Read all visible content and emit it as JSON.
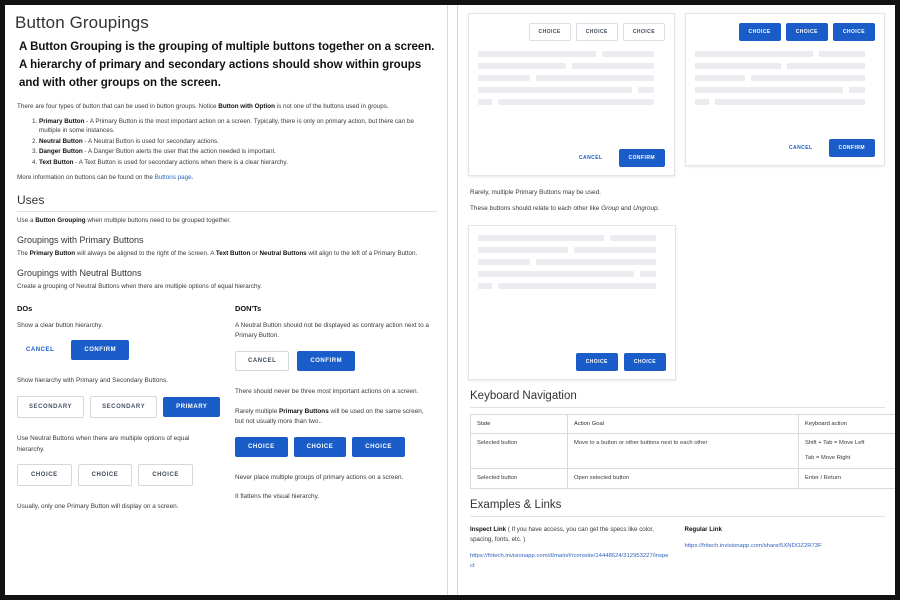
{
  "left": {
    "page_title": "Button Groupings",
    "lede": "A Button Grouping is the grouping of multiple buttons together on a screen. A hierarchy of primary and secondary actions should show within groups and with other groups on the screen.",
    "intro_before": "There are four types of button that can be used in button groups. Notice ",
    "intro_bold": "Button with Option",
    "intro_after": " is not one of the buttons used in groups.",
    "types": [
      {
        "term": "Primary Button",
        "desc": " - A Primary Button is the most important action on a screen. Typically, there is only on primary action, but there can be multiple in some instances."
      },
      {
        "term": "Neutral Button",
        "desc": " - A Neutral Button is used for secondary actions."
      },
      {
        "term": "Danger Button",
        "desc": " - A Danger Button alerts the user that the action needed is important."
      },
      {
        "term": "Text Button",
        "desc": " - A Text Button is used for secondary actions when there is a clear hierarchy."
      }
    ],
    "more_info_before": "More information on buttons can be found on the ",
    "more_info_link": "Buttons page",
    "more_info_after": ".",
    "uses_heading": "Uses",
    "uses_before": "Use a ",
    "uses_bold": "Button Grouping",
    "uses_after": " when multiple buttons need to be grouped together.",
    "primary_heading": "Groupings with Primary Buttons",
    "primary_p1": "The ",
    "primary_b1": "Primary Button",
    "primary_p2": " will always be aligned to the right of the screen. A ",
    "primary_b2": "Text Button",
    "primary_p3": " or ",
    "primary_b3": "Neutral Buttons",
    "primary_p4": " will align to the left of a Primary Button.",
    "neutral_heading": "Groupings with Neutral Buttons",
    "neutral_text": "Create a grouping of Neutral Buttons when there are multiple options of equal hierarchy.",
    "dos": {
      "heading": "DOs",
      "p1": "Show a clear button hierarchy.",
      "btn_cancel": "CANCEL",
      "btn_confirm": "CONFIRM",
      "p2": "Show hierarchy with Primary and Secondary Buttons.",
      "btn_secondary_1": "SECONDARY",
      "btn_secondary_2": "SECONDARY",
      "btn_primary": "PRIMARY",
      "p3": "Use Neutral Buttons when there are multiple options of equal hierarchy.",
      "choice_1": "CHOICE",
      "choice_2": "CHOICE",
      "choice_3": "CHOICE",
      "p4": "Usually, only one Primary Button will display on a screen."
    },
    "donts": {
      "heading": "DON'Ts",
      "p1": "A Neutral Button should not be displayed as contrary action next to a Primary Button.",
      "btn_cancel": "CANCEL",
      "btn_confirm": "CONFIRM",
      "p2": "There should never be three most important actions on a screen.",
      "p3_a": "Rarely multiple ",
      "p3_b": "Primary Buttons",
      "p3_c": " will be used on the same screen, but not usually more than two..",
      "choice_1": "CHOICE",
      "choice_2": "CHOICE",
      "choice_3": "CHOICE",
      "p4": "Never place multiple groups of primary actions on a screen.",
      "p5": "It flattens the visual hierarchy."
    }
  },
  "right": {
    "mock_a": {
      "choice_1": "CHOICE",
      "choice_2": "CHOICE",
      "choice_3": "CHOICE",
      "cancel": "CANCEL",
      "confirm": "CONFIRM"
    },
    "mock_b": {
      "choice_1": "CHOICE",
      "choice_2": "CHOICE",
      "choice_3": "CHOICE",
      "cancel": "CANCEL",
      "confirm": "CONFIRM"
    },
    "mock_c": {
      "choice_1": "CHOICE",
      "choice_2": "CHOICE"
    },
    "note_1": "Rarely, multiple Primary Buttons may be used.",
    "note_2_a": "These buttons should relate to each other like ",
    "note_2_i1": "Group",
    "note_2_b": " and ",
    "note_2_i2": "Ungroup",
    "note_2_c": ".",
    "keyboard": {
      "heading": "Keyboard Navigation",
      "columns": [
        "State",
        "Action Goal",
        "Keyboard action"
      ],
      "rows": [
        {
          "state": "Selected button",
          "goal": "Move to a button or other buttons next to each other",
          "action_1": "Shift + Tab = Move Left",
          "action_2": "Tab = Move Right"
        },
        {
          "state": "Selected button",
          "goal": "Open selected button",
          "action_1": "Enter / Return",
          "action_2": ""
        }
      ]
    },
    "examples": {
      "heading": "Examples & Links",
      "inspect_bold": "Inspect Link",
      "inspect_rest": " ( If you have access, you can get the specs like color, spacing, fonts, etc. )",
      "inspect_url": "https://fritech.invisionapp.com/d/main/#/console/14448624/312953227/inspect",
      "regular_label": "Regular Link",
      "regular_url": "https://fritech.invisionapp.com/share/5XNDOZ2R73F"
    }
  },
  "colors": {
    "primary_blue": "#1a5dc8",
    "link_blue": "#2a66c8",
    "skeleton": "#ebecef"
  }
}
